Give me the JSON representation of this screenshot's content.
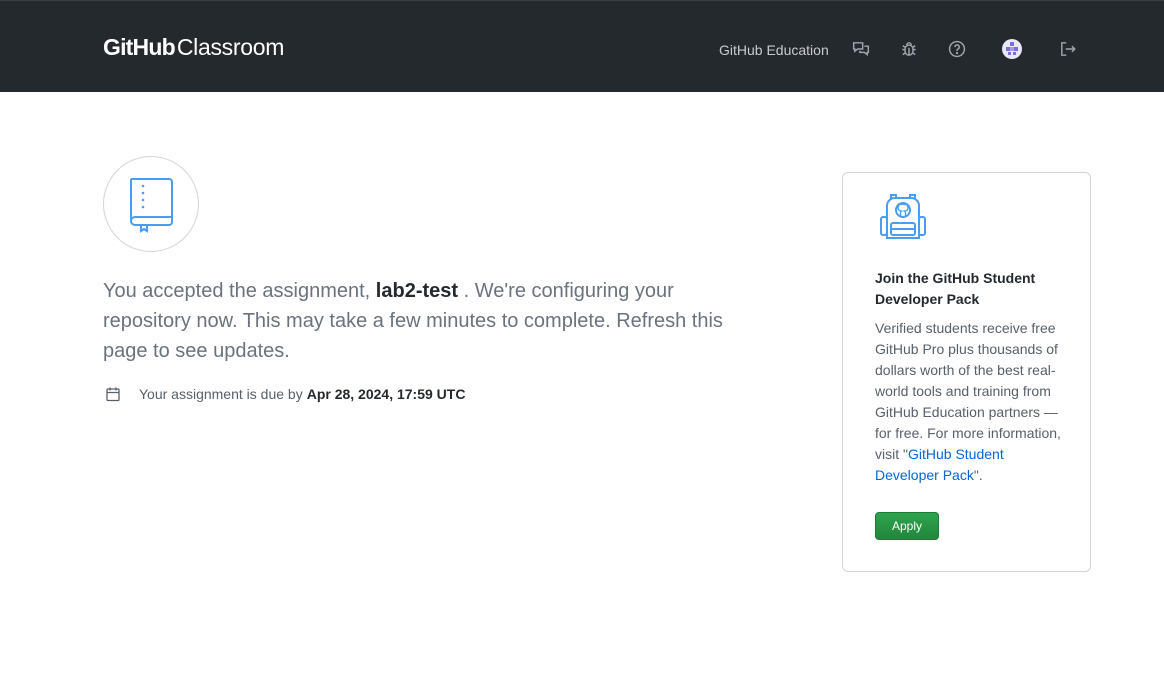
{
  "header": {
    "brand_github": "GitHub",
    "brand_classroom": "Classroom",
    "education_link": "GitHub Education",
    "icons": [
      "feedback-icon",
      "bug-icon",
      "help-icon",
      "avatar",
      "sign-out-icon"
    ]
  },
  "main": {
    "message_prefix": "You accepted the assignment, ",
    "assignment_name": "lab2-test",
    "message_suffix": " . We're configuring your repository now. This may take a few minutes to complete. Refresh this page to see updates.",
    "due_prefix": "Your assignment is due by",
    "due_date": "Apr 28, 2024, 17:59 UTC"
  },
  "promo": {
    "title": "Join the GitHub Student Developer Pack",
    "body_prefix": "Verified students receive free GitHub Pro plus thousands of dollars worth of the best real-world tools and training from GitHub Education partners — for free. For more information, visit \"",
    "link_text": "GitHub Student Developer Pack",
    "body_suffix": "\".",
    "apply_label": "Apply"
  },
  "colors": {
    "header_bg": "#24292e",
    "link": "#0366d6",
    "apply_green": "#2ea44f",
    "icon_blue": "#4a9df0"
  }
}
